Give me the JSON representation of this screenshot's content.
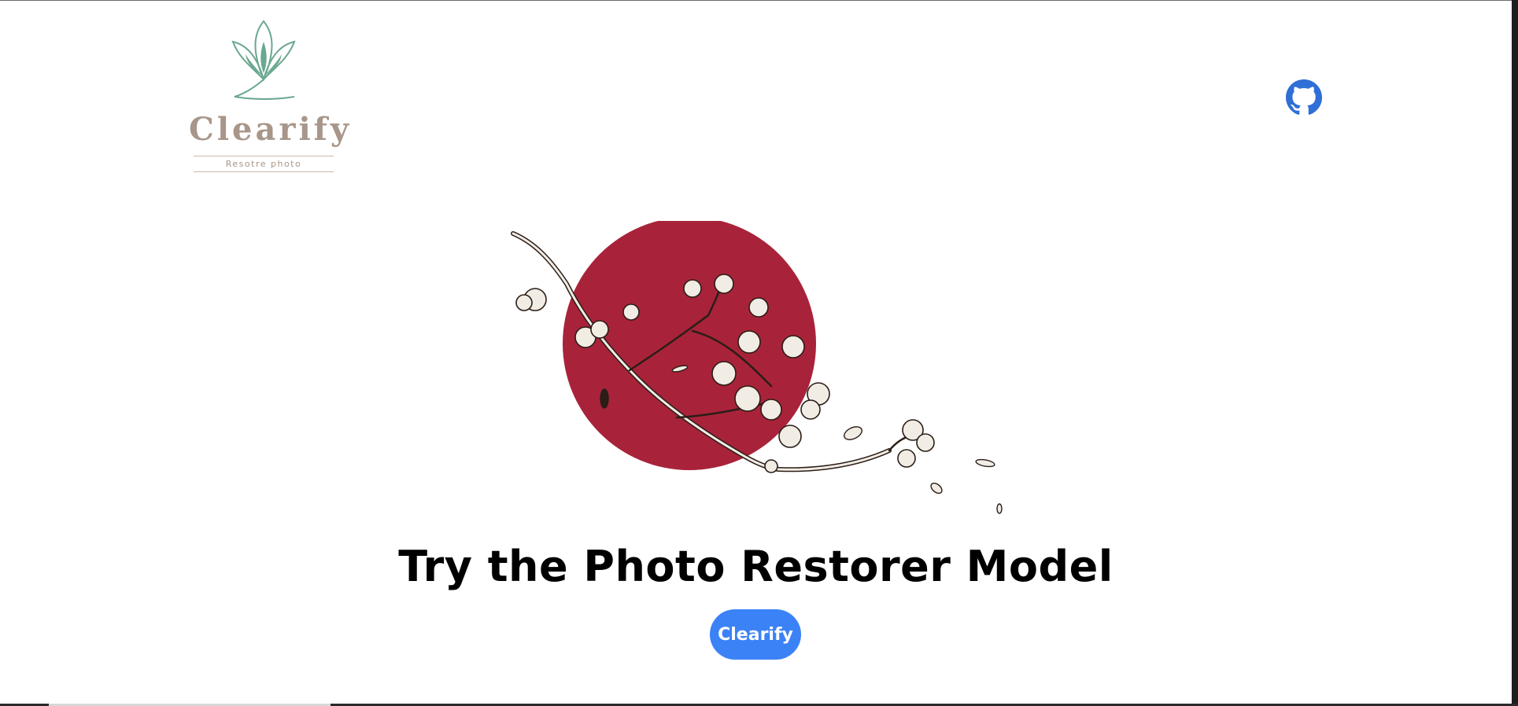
{
  "header": {
    "logo": {
      "wordmark": "Clearify",
      "tagline": "Resotre photo",
      "icon": "lotus-leaf-icon",
      "colors": {
        "leaf": "#6aa88f",
        "text": "#a8968a"
      }
    },
    "github": {
      "icon": "github-icon",
      "color": "#2f6fd6"
    }
  },
  "hero": {
    "illustration": "cherry-blossom-branch-red-sun",
    "colors": {
      "sun": "#a8233a",
      "petal": "#f1ece4",
      "outline": "#2b1d17"
    }
  },
  "main": {
    "headline": "Try the Photo Restorer Model",
    "cta_label": "Clearify",
    "cta_color": "#3b82f6"
  }
}
